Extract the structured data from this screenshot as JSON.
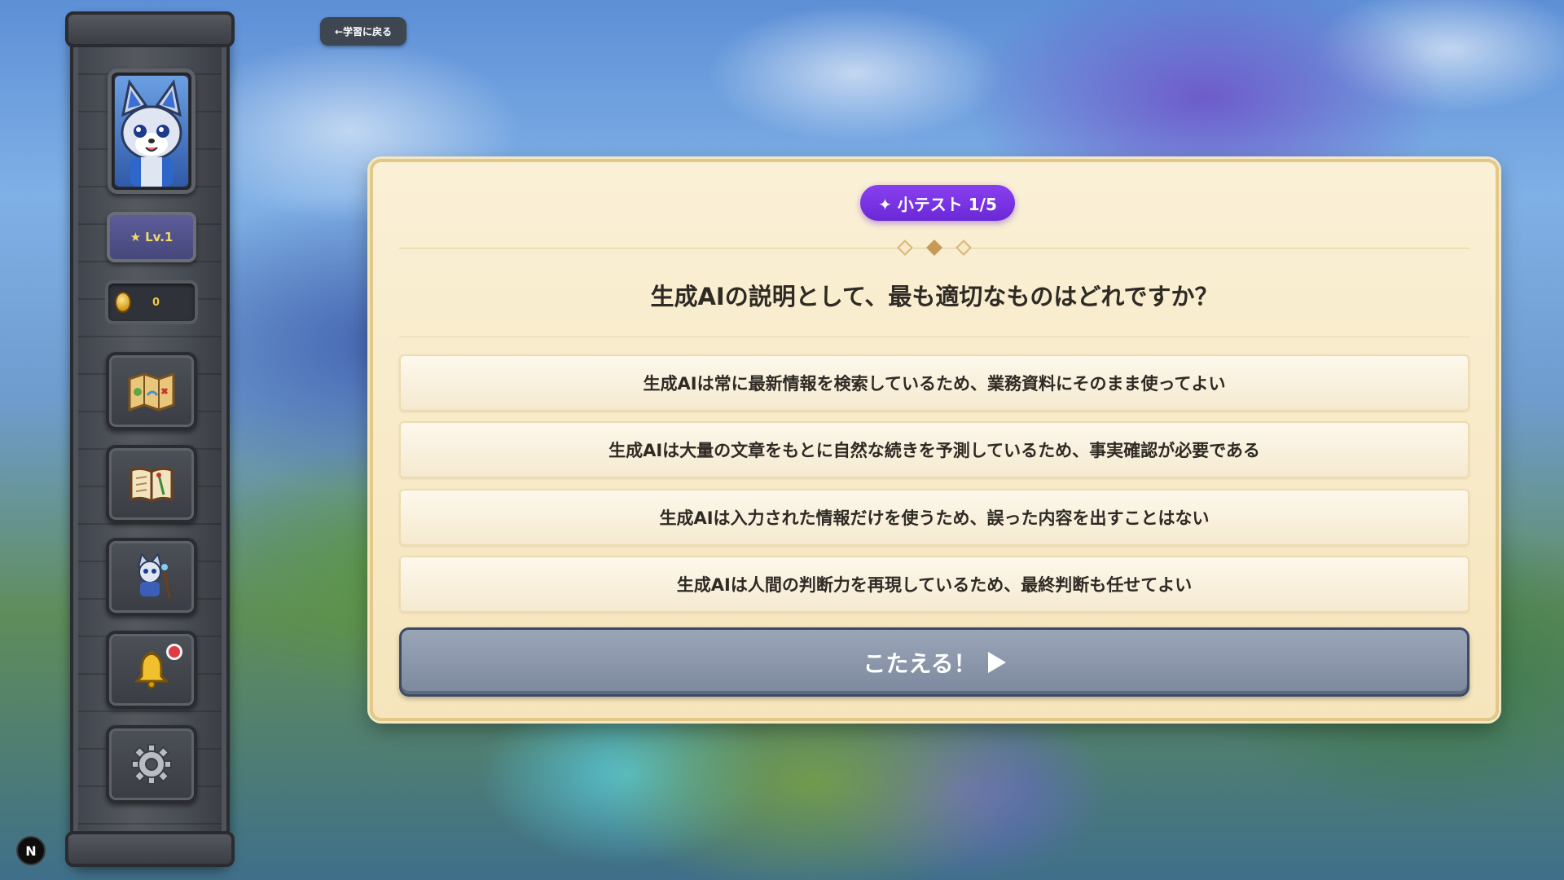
{
  "header": {
    "back_label": "←学習に戻る"
  },
  "sidebar": {
    "level_label": "Lv.1",
    "coins": "0",
    "nav_items": [
      {
        "name": "map",
        "icon": "map-icon"
      },
      {
        "name": "book",
        "icon": "book-icon"
      },
      {
        "name": "character",
        "icon": "character-icon"
      },
      {
        "name": "notifications",
        "icon": "bell-icon",
        "has_notification": true
      },
      {
        "name": "settings",
        "icon": "gear-icon"
      }
    ]
  },
  "quiz": {
    "badge_label": "✦ 小テスト 1/5",
    "question": "生成AIの説明として、最も適切なものはどれですか？",
    "options": [
      "生成AIは常に最新情報を検索しているため、業務資料にそのまま使ってよい",
      "生成AIは大量の文章をもとに自然な続きを予測しているため、事実確認が必要である",
      "生成AIは入力された情報だけを使うため、誤った内容を出すことはない",
      "生成AIは人間の判断力を再現しているため、最終判断も任せてよい"
    ],
    "submit_label": "こたえる！"
  },
  "footer": {
    "badge_letter": "N"
  },
  "colors": {
    "accent_purple": "#7a34e4",
    "panel_bg": "#f8ebc9",
    "submit_bg": "#8a95aa",
    "notification_red": "#e03a44"
  }
}
